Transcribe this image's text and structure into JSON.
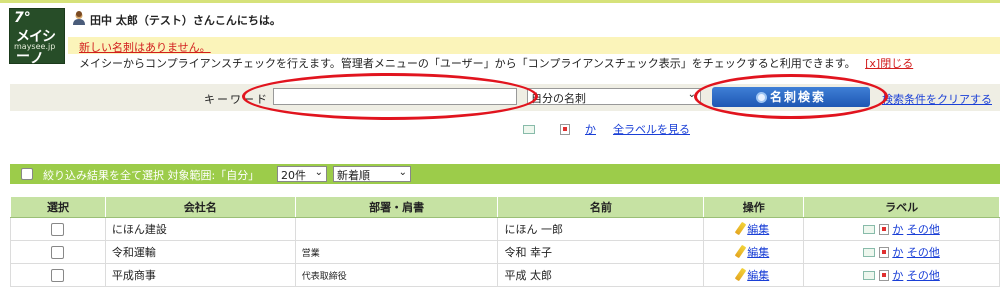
{
  "header": {
    "logo_text": [
      "7°",
      "メイシー",
      "maysee.jp",
      "ノ"
    ],
    "greeting": "田中 太郎（テスト）さんこんにちは。",
    "notice": "新しい名刺はありません。",
    "compliance_text": "メイシーからコンプライアンスチェックを行えます。管理者メニューの「ユーザー」から「コンプライアンスチェック表示」をチェックすると利用できます。",
    "close_link": "[x]閉じる"
  },
  "search": {
    "keyword_label": "キーワード",
    "keyword_value": "",
    "scope_selected": "自分の名刺",
    "button_label": "名刺検索",
    "clear_link": "検索条件をクリアする"
  },
  "filters": {
    "kana_link": "か",
    "all_labels_link": "全ラベルを見る"
  },
  "toolbar": {
    "select_all_label": "絞り込み結果を全て選択 対象範囲:「自分」",
    "count_selected": "20件",
    "sort_selected": "新着順"
  },
  "table": {
    "headers": [
      "選択",
      "会社名",
      "部署・肩書",
      "名前",
      "操作",
      "ラベル"
    ],
    "rows": [
      {
        "company": "にほん建設",
        "dept": "",
        "name": "にほん 一郎",
        "action": "編集",
        "label_kana": "か",
        "label_other": "その他"
      },
      {
        "company": "令和運輸",
        "dept": "営業",
        "name": "令和 幸子",
        "action": "編集",
        "label_kana": "か",
        "label_other": "その他"
      },
      {
        "company": "平成商事",
        "dept": "代表取締役",
        "name": "平成 太郎",
        "action": "編集",
        "label_kana": "か",
        "label_other": "その他"
      }
    ]
  },
  "colors": {
    "accent_green": "#9ccc4a",
    "header_green": "#c6e2a3",
    "button_blue": "#1e57b3",
    "annotation_red": "#e1141e"
  }
}
